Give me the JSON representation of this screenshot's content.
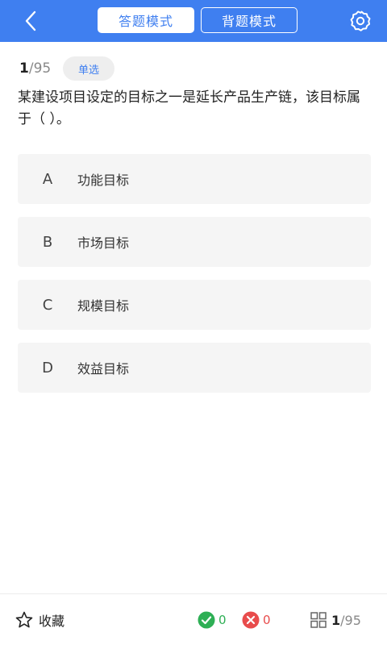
{
  "colors": {
    "accent": "#3f7ff0",
    "correct": "#2eaf55",
    "wrong": "#e84c4c"
  },
  "header": {
    "back_icon": "chevron-left-icon",
    "tabs": [
      {
        "label": "答题模式",
        "active": true
      },
      {
        "label": "背题模式",
        "active": false
      }
    ],
    "settings_icon": "gear-icon"
  },
  "question": {
    "current": "1",
    "separator": "/",
    "total": "95",
    "type": "单选",
    "text": "某建设项目设定的目标之一是延长产品生产链，该目标属于（ ）。",
    "options": [
      {
        "letter": "A",
        "text": "功能目标"
      },
      {
        "letter": "B",
        "text": "市场目标"
      },
      {
        "letter": "C",
        "text": "规模目标"
      },
      {
        "letter": "D",
        "text": "效益目标"
      }
    ]
  },
  "footer": {
    "favorite_icon": "star-outline-icon",
    "favorite_label": "收藏",
    "correct_count": "0",
    "wrong_count": "0",
    "card_icon": "answer-card-grid-icon",
    "current": "1",
    "separator": "/",
    "total": "95"
  }
}
